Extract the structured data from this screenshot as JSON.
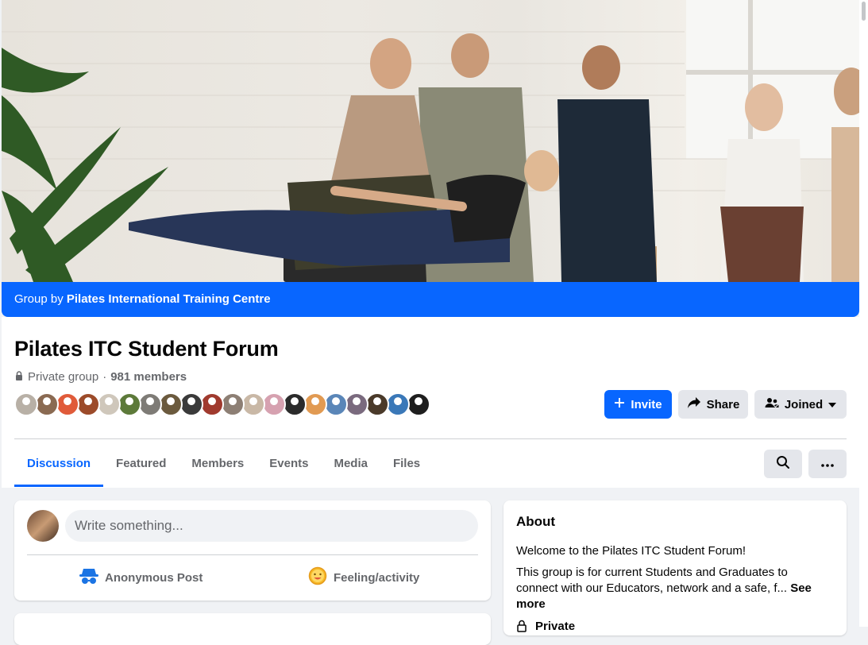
{
  "cover": {
    "banner_prefix": "Group by",
    "banner_owner": "Pilates International Training Centre"
  },
  "group": {
    "title": "Pilates ITC Student Forum",
    "privacy": "Private group",
    "separator": "·",
    "members": "981 members"
  },
  "member_avatars": [
    "#b8b0a6",
    "#8a6a52",
    "#e05b3a",
    "#9c4b2a",
    "#cfc7bb",
    "#5d7a3a",
    "#7e7b76",
    "#6b5a3e",
    "#3a3a3a",
    "#a03a2e",
    "#8d7f74",
    "#c9b8a6",
    "#d6a1b0",
    "#2b2b2b",
    "#e19a52",
    "#5a86b8",
    "#7a6a7e",
    "#4a3a2a",
    "#3a78b8",
    "#1e1e1e"
  ],
  "actions": {
    "invite": "Invite",
    "share": "Share",
    "joined": "Joined"
  },
  "tabs": [
    "Discussion",
    "Featured",
    "Members",
    "Events",
    "Media",
    "Files"
  ],
  "composer": {
    "placeholder": "Write something...",
    "anonymous": "Anonymous Post",
    "feeling": "Feeling/activity"
  },
  "about": {
    "heading": "About",
    "welcome": "Welcome to the Pilates ITC Student Forum!",
    "description": "This group is for current Students and Graduates to connect with our Educators, network and a safe, f...",
    "see_more": "See more",
    "privacy": "Private"
  },
  "colors": {
    "brand_blue": "#0866ff",
    "button_gray": "#e4e6eb",
    "text_secondary": "#65676b"
  }
}
